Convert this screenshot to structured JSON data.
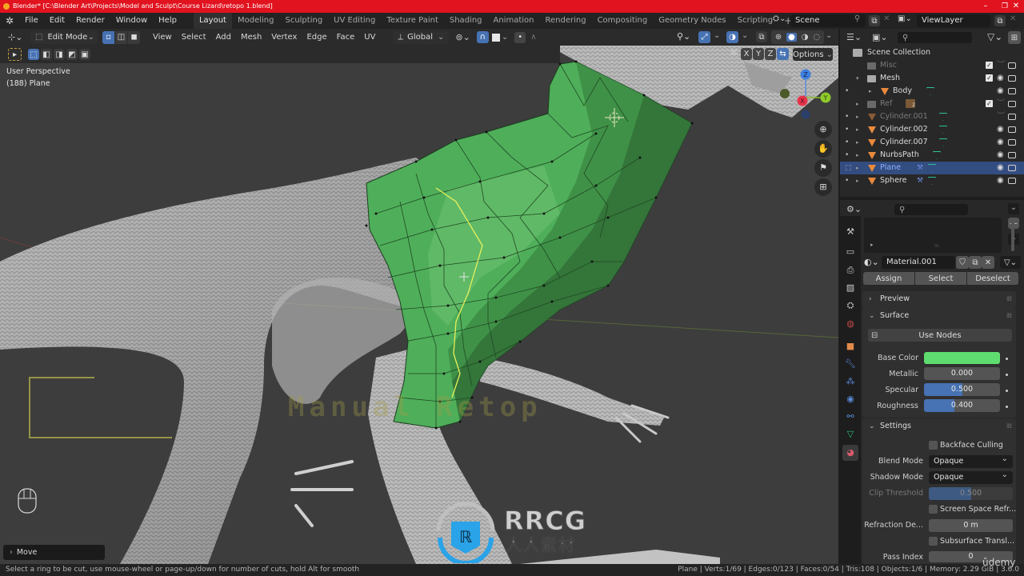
{
  "window": {
    "title": "Blender* [C:\\Blender Art\\Projects\\Model and Sculpt\\Course Lizard\\retopo 1.blend]",
    "controls": [
      "–",
      "❐",
      "✕"
    ]
  },
  "menubar": {
    "menus": [
      "File",
      "Edit",
      "Render",
      "Window",
      "Help"
    ],
    "workspaces": [
      "Layout",
      "Modeling",
      "Sculpting",
      "UV Editing",
      "Texture Paint",
      "Shading",
      "Animation",
      "Rendering",
      "Compositing",
      "Geometry Nodes",
      "Scripting"
    ],
    "active_workspace": "Layout",
    "add_workspace": "+",
    "scene": "Scene",
    "view_layer": "ViewLayer"
  },
  "viewport_header": {
    "mode": "Edit Mode",
    "menus": [
      "View",
      "Select",
      "Add",
      "Mesh",
      "Vertex",
      "Edge",
      "Face",
      "UV"
    ],
    "transform_orientation": "Global",
    "axis_labels": [
      "X",
      "Y",
      "Z"
    ],
    "options_label": "Options"
  },
  "viewport": {
    "view_name": "User Perspective",
    "object_info": "(188) Plane",
    "overlay_text": "Manual Retop",
    "last_operator": "Move",
    "gizmo_axes": [
      "Z",
      "X",
      "Y"
    ],
    "watermark": {
      "brand": "RRCG",
      "subtitle": "人人素材"
    }
  },
  "outliner": {
    "root": "Scene Collection",
    "rows": [
      {
        "name": "Misc",
        "type": "collection",
        "checked": true,
        "visible": false,
        "dim": true
      },
      {
        "name": "Mesh",
        "type": "collection",
        "checked": true,
        "visible": true,
        "dim": false
      },
      {
        "name": "Body",
        "type": "mesh",
        "visible": true,
        "dim": false
      },
      {
        "name": "Ref",
        "type": "collection",
        "checked": true,
        "visible": false,
        "dim": true,
        "badge": "2"
      },
      {
        "name": "Cylinder.001",
        "type": "mesh",
        "visible": false,
        "dim": true
      },
      {
        "name": "Cylinder.002",
        "type": "mesh",
        "visible": true,
        "dim": false
      },
      {
        "name": "Cylinder.007",
        "type": "mesh",
        "visible": true,
        "dim": false
      },
      {
        "name": "NurbsPath",
        "type": "mesh",
        "visible": true,
        "dim": false
      },
      {
        "name": "Plane",
        "type": "mesh",
        "visible": true,
        "dim": false,
        "selected": true,
        "modifier": true
      },
      {
        "name": "Sphere",
        "type": "mesh",
        "visible": true,
        "dim": false,
        "modifier": true
      }
    ]
  },
  "properties": {
    "material_name": "Material.001",
    "slot_buttons": [
      "Assign",
      "Select",
      "Deselect"
    ],
    "panels": {
      "preview": "Preview",
      "surface": "Surface",
      "settings": "Settings"
    },
    "use_nodes_label": "Use Nodes",
    "surface": {
      "base_color_label": "Base Color",
      "base_color": "#5fdc6f",
      "metallic_label": "Metallic",
      "metallic": "0.000",
      "metallic_fraction": 0.0,
      "specular_label": "Specular",
      "specular": "0.500",
      "specular_fraction": 0.5,
      "roughness_label": "Roughness",
      "roughness": "0.400",
      "roughness_fraction": 0.4
    },
    "settings": {
      "backface_culling": "Backface Culling",
      "blend_mode_label": "Blend Mode",
      "blend_mode": "Opaque",
      "shadow_mode_label": "Shadow Mode",
      "shadow_mode": "Opaque",
      "clip_threshold_label": "Clip Threshold",
      "clip_threshold": "0.500",
      "clip_threshold_fraction": 0.5,
      "screen_space_refraction": "Screen Space Refr...",
      "refraction_depth_label": "Refraction De...",
      "refraction_depth": "0 m",
      "subsurface_translucency": "Subsurface Transl...",
      "pass_index_label": "Pass Index",
      "pass_index": "0"
    }
  },
  "statusbar": {
    "hint": "Select a ring to be cut, use mouse-wheel or page-up/down for number of cuts, hold Alt for smooth",
    "stats": "Plane | Verts:1/69 | Edges:0/123 | Faces:0/54 | Tris:108 | Objects:1/6 | Memory: 2.29 GiB | 3.6.0",
    "udemy": "ûdemy"
  },
  "colors": {
    "title_bar": "#e0131f",
    "accent_blue": "#4772b3",
    "mesh_green": "#4fae5a",
    "selection_row": "#334d80"
  }
}
